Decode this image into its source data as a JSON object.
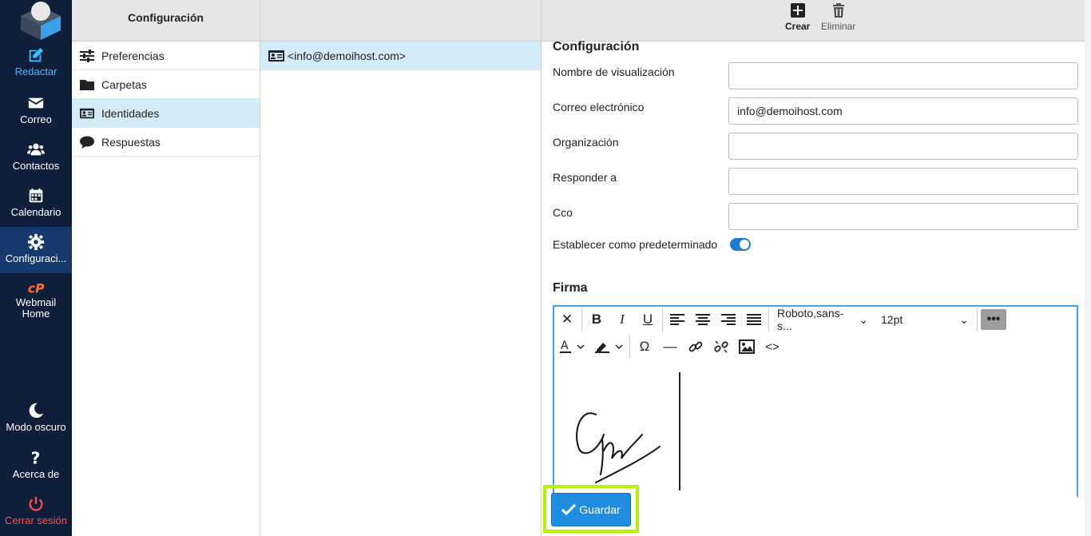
{
  "nav": {
    "compose": "Redactar",
    "mail": "Correo",
    "contacts": "Contactos",
    "calendar": "Calendario",
    "settings": "Configuraci...",
    "cpanel_line1": "Webmail",
    "cpanel_line2": "Home",
    "dark_mode": "Modo oscuro",
    "about": "Acerca de",
    "logout": "Cerrar sesión",
    "accent_color": "#37beff",
    "logout_color": "#ff4d4d"
  },
  "settings_menu": {
    "title": "Configuración",
    "items": [
      {
        "label": "Preferencias",
        "icon": "sliders-icon"
      },
      {
        "label": "Carpetas",
        "icon": "folder-icon"
      },
      {
        "label": "Identidades",
        "icon": "id-card-icon"
      },
      {
        "label": "Respuestas",
        "icon": "speech-bubble-icon"
      }
    ]
  },
  "identities": {
    "items": [
      "<info@demoihost.com>"
    ]
  },
  "toolbar": {
    "create": "Crear",
    "delete": "Eliminar"
  },
  "form": {
    "section_title": "Configuración",
    "display_name_label": "Nombre de visualización",
    "display_name_value": "",
    "email_label": "Correo electrónico",
    "email_value": "info@demoihost.com",
    "organization_label": "Organización",
    "organization_value": "",
    "reply_to_label": "Responder a",
    "reply_to_value": "",
    "bcc_label": "Cco",
    "bcc_value": "",
    "default_label": "Establecer como predeterminado",
    "default_enabled": true,
    "signature_title": "Firma"
  },
  "editor": {
    "font_family": "Roboto,sans-s...",
    "font_size": "12pt"
  },
  "save_button": "Guardar"
}
